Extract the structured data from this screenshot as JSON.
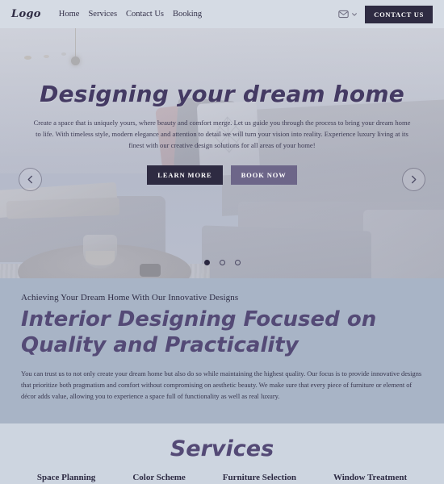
{
  "navbar": {
    "logo": "Logo",
    "links": [
      {
        "label": "Home"
      },
      {
        "label": "Services"
      },
      {
        "label": "Contact Us"
      },
      {
        "label": "Booking"
      }
    ],
    "mail_icon": "mail-icon",
    "chevron_icon": "chevron-down-icon",
    "cta_label": "CONTACT US"
  },
  "hero": {
    "title": "Designing your dream home",
    "paragraph": "Create a space that is uniquely yours, where beauty and comfort merge. Let us guide you through the process to bring your dream home to life. With timeless style, modern elegance and attention to detail we will turn your vision into reality. Experience luxury living at its finest with our creative design solutions for all areas of your home!",
    "primary_button": "LEARN MORE",
    "secondary_button": "BOOK NOW",
    "prev_icon": "chevron-left-icon",
    "next_icon": "chevron-right-icon",
    "slides": [
      {
        "active": true
      },
      {
        "active": false
      },
      {
        "active": false
      }
    ]
  },
  "about": {
    "subtitle": "Achieving Your Dream Home With Our Innovative Designs",
    "title": "Interior Designing Focused on Quality and Practicality",
    "paragraph": "You can trust us to not only create your dream home but also do so while maintaining the highest quality. Our focus is to provide innovative designs that prioritize both pragmatism and comfort without compromising on aesthetic beauty. We make sure that every piece of furniture or element of décor adds value, allowing you to experience a space full of functionality as well as real luxury."
  },
  "services": {
    "title": "Services",
    "tabs": [
      {
        "label": "Space Planning"
      },
      {
        "label": "Color Scheme"
      },
      {
        "label": "Furniture Selection"
      },
      {
        "label": "Window Treatment"
      }
    ]
  },
  "colors": {
    "nav_bg": "#d5dbe4",
    "dark_accent": "#2e2b42",
    "purple_accent": "#544a76",
    "button_secondary": "#6d6689",
    "about_bg": "#a8b4c6",
    "services_bg": "#cdd5e0"
  }
}
